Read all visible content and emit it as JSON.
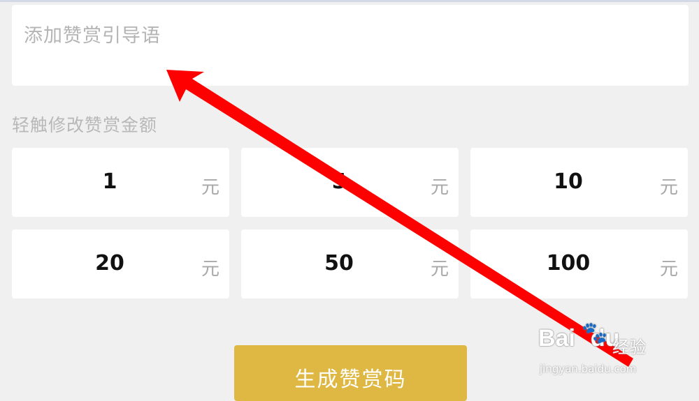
{
  "guide": {
    "placeholder": "添加赞赏引导语"
  },
  "amounts": {
    "label": "轻触修改赞赏金额",
    "unit": "元",
    "items": [
      {
        "value": "1"
      },
      {
        "value": "5"
      },
      {
        "value": "10"
      },
      {
        "value": "20"
      },
      {
        "value": "50"
      },
      {
        "value": "100"
      }
    ]
  },
  "action": {
    "generate_label": "生成赞赏码"
  },
  "watermark": {
    "logo": "Bai",
    "logo_suffix": "du",
    "brand": "经验",
    "url": "jingyan.baidu.com"
  },
  "colors": {
    "button": "#deb842",
    "annotation_arrow": "#ff0000",
    "background": "#f0f0f0"
  }
}
